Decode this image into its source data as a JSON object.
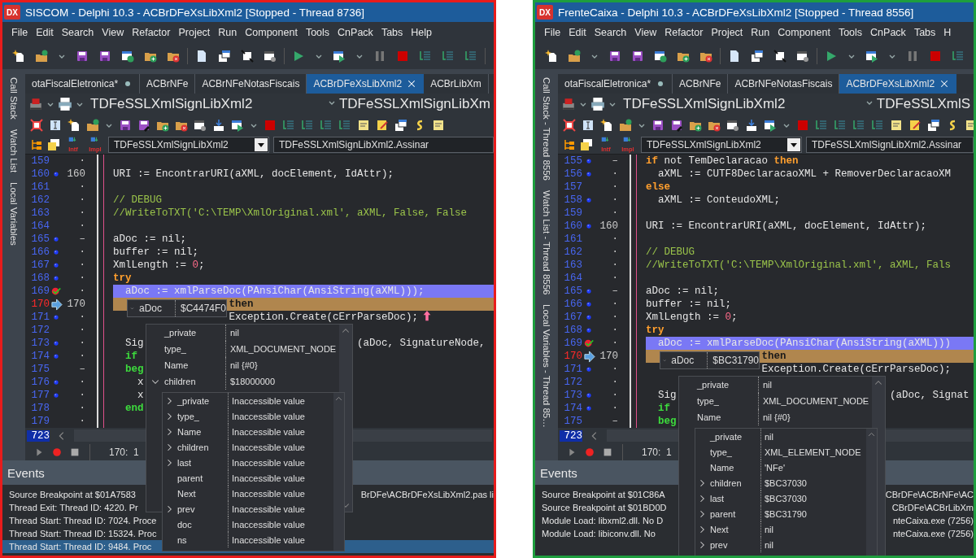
{
  "windows": [
    {
      "badge": "DX",
      "title": "SISCOM - Delphi 10.3 - ACBrDFeXsLibXml2 [Stopped - Thread 8736]",
      "menu": [
        "File",
        "Edit",
        "Search",
        "View",
        "Refactor",
        "Project",
        "Run",
        "Component",
        "Tools",
        "CnPack",
        "Tabs",
        "Help"
      ],
      "side_tabs": [
        "Call Stack",
        "Watch List",
        "Local Variables"
      ],
      "tabs": [
        {
          "label": "otaFiscalEletronica*",
          "modified": true,
          "selected": false
        },
        {
          "label": "ACBrNFe",
          "modified": false,
          "selected": false
        },
        {
          "label": "ACBrNFeNotasFiscais",
          "modified": false,
          "selected": false
        },
        {
          "label": "ACBrDFeXsLibXml2",
          "modified": false,
          "selected": true
        },
        {
          "label": "ACBrLibXm",
          "modified": false,
          "selected": false
        }
      ],
      "unit_class": "TDFeSSLXmlSignLibXml2",
      "unit_class_right": "TDFeSSLXmlSignLibXm",
      "nav_labels": [
        "Intf",
        "Impl"
      ],
      "class_combo": "TDFeSSLXmlSignLibXml2",
      "method_combo": "TDFeSSLXmlSignLibXml2.Assinar",
      "lines": [
        {
          "num": "159",
          "dot": false,
          "mark": "·",
          "breakpoint": false,
          "execution_point": false
        },
        {
          "num": "160",
          "dot": true,
          "mark": "160",
          "breakpoint": false,
          "execution_point": false,
          "code": [
            {
              "kind": "plain",
              "text": "URI := EncontrarURI(aXML, docElement, IdAttr);"
            }
          ]
        },
        {
          "num": "161",
          "dot": false,
          "mark": "·",
          "breakpoint": false,
          "execution_point": false
        },
        {
          "num": "162",
          "dot": false,
          "mark": "·",
          "breakpoint": false,
          "execution_point": false,
          "code": [
            {
              "kind": "comment",
              "text": "// DEBUG"
            }
          ]
        },
        {
          "num": "163",
          "dot": false,
          "mark": "·",
          "breakpoint": false,
          "execution_point": false,
          "code": [
            {
              "kind": "comment",
              "text": "//WriteToTXT('C:\\TEMP\\XmlOriginal.xml', aXML, False, False"
            }
          ]
        },
        {
          "num": "164",
          "dot": false,
          "mark": "·",
          "breakpoint": false,
          "execution_point": false
        },
        {
          "num": "165",
          "dot": true,
          "mark": "–",
          "breakpoint": false,
          "execution_point": false,
          "code": [
            {
              "kind": "plain",
              "text": "aDoc := nil;"
            }
          ]
        },
        {
          "num": "166",
          "dot": true,
          "mark": "·",
          "breakpoint": false,
          "execution_point": false,
          "code": [
            {
              "kind": "plain",
              "text": "buffer := nil;"
            }
          ]
        },
        {
          "num": "167",
          "dot": true,
          "mark": "·",
          "breakpoint": false,
          "execution_point": false,
          "code": [
            {
              "kind": "plain",
              "text": "XmlLength := "
            },
            {
              "kind": "num",
              "text": "0"
            },
            {
              "kind": "plain",
              "text": ";"
            }
          ]
        },
        {
          "num": "168",
          "dot": true,
          "mark": "·",
          "breakpoint": false,
          "execution_point": false,
          "code": [
            {
              "kind": "kw",
              "text": "try"
            }
          ]
        },
        {
          "num": "169",
          "dot": false,
          "mark": "·",
          "breakpoint": true,
          "execution_point": false,
          "code": [
            {
              "kind": "plain",
              "text": "  aDoc := xmlParseDoc(PAnsiChar(AnsiString(aXML)));"
            }
          ]
        },
        {
          "num": "170",
          "dot": false,
          "mark": "170",
          "breakpoint": false,
          "execution_point": true,
          "code": [
            {
              "kind": "kw",
              "text": "                   then"
            }
          ]
        },
        {
          "num": "171",
          "dot": true,
          "mark": "·",
          "breakpoint": false,
          "execution_point": false,
          "jump_mark": true,
          "code": [
            {
              "kind": "plain",
              "text": "                   Exception.Create(cErrParseDoc);"
            }
          ]
        },
        {
          "num": "172",
          "dot": false,
          "mark": "·",
          "breakpoint": false,
          "execution_point": false
        },
        {
          "num": "173",
          "dot": true,
          "mark": "·",
          "breakpoint": false,
          "execution_point": false,
          "code": [
            {
              "kind": "plain",
              "text": "  Sig"
            }
          ],
          "code_right": [
            {
              "kind": "plain",
              "text": "                                   (aDoc, SignatureNode,"
            }
          ]
        },
        {
          "num": "174",
          "dot": true,
          "mark": "·",
          "breakpoint": false,
          "execution_point": false,
          "code": [
            {
              "kind": "kw2",
              "text": "  if"
            }
          ]
        },
        {
          "num": "175",
          "dot": false,
          "mark": "–",
          "breakpoint": false,
          "execution_point": false,
          "code": [
            {
              "kind": "kw2",
              "text": "  beg"
            }
          ]
        },
        {
          "num": "176",
          "dot": true,
          "mark": "·",
          "breakpoint": false,
          "execution_point": false,
          "code": [
            {
              "kind": "plain",
              "text": "    x"
            }
          ]
        },
        {
          "num": "177",
          "dot": true,
          "mark": "·",
          "breakpoint": false,
          "execution_point": false,
          "code": [
            {
              "kind": "plain",
              "text": "    x"
            }
          ]
        },
        {
          "num": "178",
          "dot": false,
          "mark": "·",
          "breakpoint": false,
          "execution_point": false,
          "code": [
            {
              "kind": "kw2",
              "text": "  end"
            }
          ]
        },
        {
          "num": "179",
          "dot": false,
          "mark": "·",
          "breakpoint": false,
          "execution_point": false
        }
      ],
      "line_count": "723",
      "position": "170:  1",
      "watch": {
        "name": "aDoc",
        "value": "$C4474F0",
        "expanded": true,
        "fields": [
          {
            "name": "_private",
            "value": "nil",
            "expandable": false
          },
          {
            "name": "type_",
            "value": "XML_DOCUMENT_NODE",
            "expandable": false
          },
          {
            "name": "Name",
            "value": "nil {#0}",
            "expandable": false
          },
          {
            "name": "children",
            "value": "$18000000",
            "expandable": true,
            "expanded": true
          }
        ],
        "child_fields": [
          {
            "name": "_private",
            "value": "Inaccessible value",
            "expandable": true,
            "expanded": false
          },
          {
            "name": "type_",
            "value": "Inaccessible value",
            "expandable": true,
            "expanded": false
          },
          {
            "name": "Name",
            "value": "Inaccessible value",
            "expandable": true,
            "expanded": false
          },
          {
            "name": "children",
            "value": "Inaccessible value",
            "expandable": true,
            "expanded": false
          },
          {
            "name": "last",
            "value": "Inaccessible value",
            "expandable": true,
            "expanded": false
          },
          {
            "name": "parent",
            "value": "Inaccessible value",
            "expandable": false
          },
          {
            "name": "Next",
            "value": "Inaccessible value",
            "expandable": false
          },
          {
            "name": "prev",
            "value": "Inaccessible value",
            "expandable": true,
            "expanded": false
          },
          {
            "name": "doc",
            "value": "Inaccessible value",
            "expandable": false
          },
          {
            "name": "ns",
            "value": "Inaccessible value",
            "expandable": false
          }
        ]
      },
      "events_title": "Events",
      "events": [
        {
          "text": "Source Breakpoint at $01A7583",
          "text_right": "BrDFe\\ACBrDFeXsLibXml2.pas li",
          "selected": false
        },
        {
          "text": "Thread Exit: Thread ID: 4220. Pr",
          "selected": false
        },
        {
          "text": "Thread Start: Thread ID: 7024. Proce",
          "selected": false
        },
        {
          "text": "Thread Start: Thread ID: 15324. Proc",
          "selected": false
        },
        {
          "text": "Thread Start: Thread ID: 9484. Proc",
          "selected": true
        }
      ]
    },
    {
      "badge": "DX",
      "title": "FrenteCaixa - Delphi 10.3 - ACBrDFeXsLibXml2 [Stopped - Thread 8556]",
      "menu": [
        "File",
        "Edit",
        "Search",
        "View",
        "Refactor",
        "Project",
        "Run",
        "Component",
        "Tools",
        "CnPack",
        "Tabs",
        "H"
      ],
      "side_tabs": [
        "Call Stack - Thread 8556",
        "Watch List - Thread 8556",
        "Local Variables - Thread 85…"
      ],
      "tabs": [
        {
          "label": "otaFiscalEletronica*",
          "modified": true,
          "selected": false
        },
        {
          "label": "ACBrNFe",
          "modified": false,
          "selected": false
        },
        {
          "label": "ACBrNFeNotasFiscais",
          "modified": false,
          "selected": false
        },
        {
          "label": "ACBrDFeXsLibXml2",
          "modified": false,
          "selected": true
        }
      ],
      "unit_class": "TDFeSSLXmlSignLibXml2",
      "unit_class_right": "TDFeSSLXmlS",
      "nav_labels": [
        "Intf",
        "Impl"
      ],
      "class_combo": "TDFeSSLXmlSignLibXml2",
      "method_combo": "TDFeSSLXmlSignLibXml2.Assinar",
      "lines": [
        {
          "num": "155",
          "dot": true,
          "mark": "–",
          "breakpoint": false,
          "execution_point": false,
          "code": [
            {
              "kind": "kw",
              "text": "if"
            },
            {
              "kind": "plain",
              "text": " not TemDeclaracao "
            },
            {
              "kind": "kw",
              "text": "then"
            }
          ]
        },
        {
          "num": "156",
          "dot": true,
          "mark": "·",
          "breakpoint": false,
          "execution_point": false,
          "code": [
            {
              "kind": "plain",
              "text": "  aXML := CUTF8DeclaracaoXML + RemoverDeclaracaoXM"
            }
          ]
        },
        {
          "num": "157",
          "dot": false,
          "mark": "·",
          "breakpoint": false,
          "execution_point": false,
          "code": [
            {
              "kind": "kw",
              "text": "else"
            }
          ]
        },
        {
          "num": "158",
          "dot": true,
          "mark": "·",
          "breakpoint": false,
          "execution_point": false,
          "code": [
            {
              "kind": "plain",
              "text": "  aXML := ConteudoXML;"
            }
          ]
        },
        {
          "num": "159",
          "dot": false,
          "mark": "·",
          "breakpoint": false,
          "execution_point": false
        },
        {
          "num": "160",
          "dot": true,
          "mark": "160",
          "breakpoint": false,
          "execution_point": false,
          "code": [
            {
              "kind": "plain",
              "text": "URI := EncontrarURI(aXML, docElement, IdAttr);"
            }
          ]
        },
        {
          "num": "161",
          "dot": false,
          "mark": "·",
          "breakpoint": false,
          "execution_point": false
        },
        {
          "num": "162",
          "dot": false,
          "mark": "·",
          "breakpoint": false,
          "execution_point": false,
          "code": [
            {
              "kind": "comment",
              "text": "// DEBUG"
            }
          ]
        },
        {
          "num": "163",
          "dot": false,
          "mark": "·",
          "breakpoint": false,
          "execution_point": false,
          "code": [
            {
              "kind": "comment",
              "text": "//WriteToTXT('C:\\TEMP\\XmlOriginal.xml', aXML, Fals"
            }
          ]
        },
        {
          "num": "164",
          "dot": false,
          "mark": "·",
          "breakpoint": false,
          "execution_point": false
        },
        {
          "num": "165",
          "dot": true,
          "mark": "–",
          "breakpoint": false,
          "execution_point": false,
          "code": [
            {
              "kind": "plain",
              "text": "aDoc := nil;"
            }
          ]
        },
        {
          "num": "166",
          "dot": true,
          "mark": "·",
          "breakpoint": false,
          "execution_point": false,
          "code": [
            {
              "kind": "plain",
              "text": "buffer := nil;"
            }
          ]
        },
        {
          "num": "167",
          "dot": true,
          "mark": "·",
          "breakpoint": false,
          "execution_point": false,
          "code": [
            {
              "kind": "plain",
              "text": "XmlLength := "
            },
            {
              "kind": "num",
              "text": "0"
            },
            {
              "kind": "plain",
              "text": ";"
            }
          ]
        },
        {
          "num": "168",
          "dot": true,
          "mark": "·",
          "breakpoint": false,
          "execution_point": false,
          "code": [
            {
              "kind": "kw",
              "text": "try"
            }
          ]
        },
        {
          "num": "169",
          "dot": false,
          "mark": "·",
          "breakpoint": true,
          "execution_point": false,
          "code": [
            {
              "kind": "plain",
              "text": "  aDoc := xmlParseDoc(PAnsiChar(AnsiString(aXML)))"
            }
          ]
        },
        {
          "num": "170",
          "dot": false,
          "mark": "170",
          "breakpoint": false,
          "execution_point": true,
          "code": [
            {
              "kind": "kw",
              "text": "                   then"
            }
          ]
        },
        {
          "num": "171",
          "dot": true,
          "mark": "·",
          "breakpoint": false,
          "execution_point": false,
          "code": [
            {
              "kind": "plain",
              "text": "                   Exception.Create(cErrParseDoc);"
            }
          ]
        },
        {
          "num": "172",
          "dot": false,
          "mark": "·",
          "breakpoint": false,
          "execution_point": false
        },
        {
          "num": "173",
          "dot": true,
          "mark": "·",
          "breakpoint": false,
          "execution_point": false,
          "code": [
            {
              "kind": "plain",
              "text": "  Sig"
            }
          ],
          "code_right": [
            {
              "kind": "plain",
              "text": "                                   (aDoc, Signat"
            }
          ]
        },
        {
          "num": "174",
          "dot": true,
          "mark": "·",
          "breakpoint": false,
          "execution_point": false,
          "code": [
            {
              "kind": "kw2",
              "text": "  if"
            }
          ]
        },
        {
          "num": "175",
          "dot": false,
          "mark": "–",
          "breakpoint": false,
          "execution_point": false,
          "code": [
            {
              "kind": "kw2",
              "text": "  beg"
            }
          ]
        }
      ],
      "line_count": "723",
      "position": "170:  1",
      "watch": {
        "name": "aDoc",
        "value": "$BC31790",
        "expanded": true,
        "fields": [
          {
            "name": "_private",
            "value": "nil",
            "expandable": false
          },
          {
            "name": "type_",
            "value": "XML_DOCUMENT_NODE",
            "expandable": false
          },
          {
            "name": "Name",
            "value": "nil {#0}",
            "expandable": false
          }
        ],
        "child_fields": [
          {
            "name": "_private",
            "value": "nil",
            "expandable": false
          },
          {
            "name": "type_",
            "value": "XML_ELEMENT_NODE",
            "expandable": false
          },
          {
            "name": "Name",
            "value": "'NFe'",
            "expandable": false
          },
          {
            "name": "children",
            "value": "$BC37030",
            "expandable": true,
            "expanded": false
          },
          {
            "name": "last",
            "value": "$BC37030",
            "expandable": true,
            "expanded": false
          },
          {
            "name": "parent",
            "value": "$BC31790",
            "expandable": true,
            "expanded": false
          },
          {
            "name": "Next",
            "value": "nil",
            "expandable": true,
            "expanded": false
          },
          {
            "name": "prev",
            "value": "nil",
            "expandable": true,
            "expanded": false
          }
        ]
      },
      "events_title": "Events",
      "events": [
        {
          "text": "Source Breakpoint at $01C86A",
          "text_right": "CBrDFe\\ACBrNFe\\AC",
          "selected": false
        },
        {
          "text": "Source Breakpoint at $01BD0D",
          "text_right": "CBrDFe\\ACBrLibXm",
          "selected": false
        },
        {
          "text": "Module Load: libxml2.dll. No D",
          "text_right": "nteCaixa.exe (7256)",
          "selected": false
        },
        {
          "text": "Module Load: libiconv.dll. No",
          "text_right": "nteCaixa.exe (7256)",
          "selected": false
        }
      ]
    }
  ]
}
